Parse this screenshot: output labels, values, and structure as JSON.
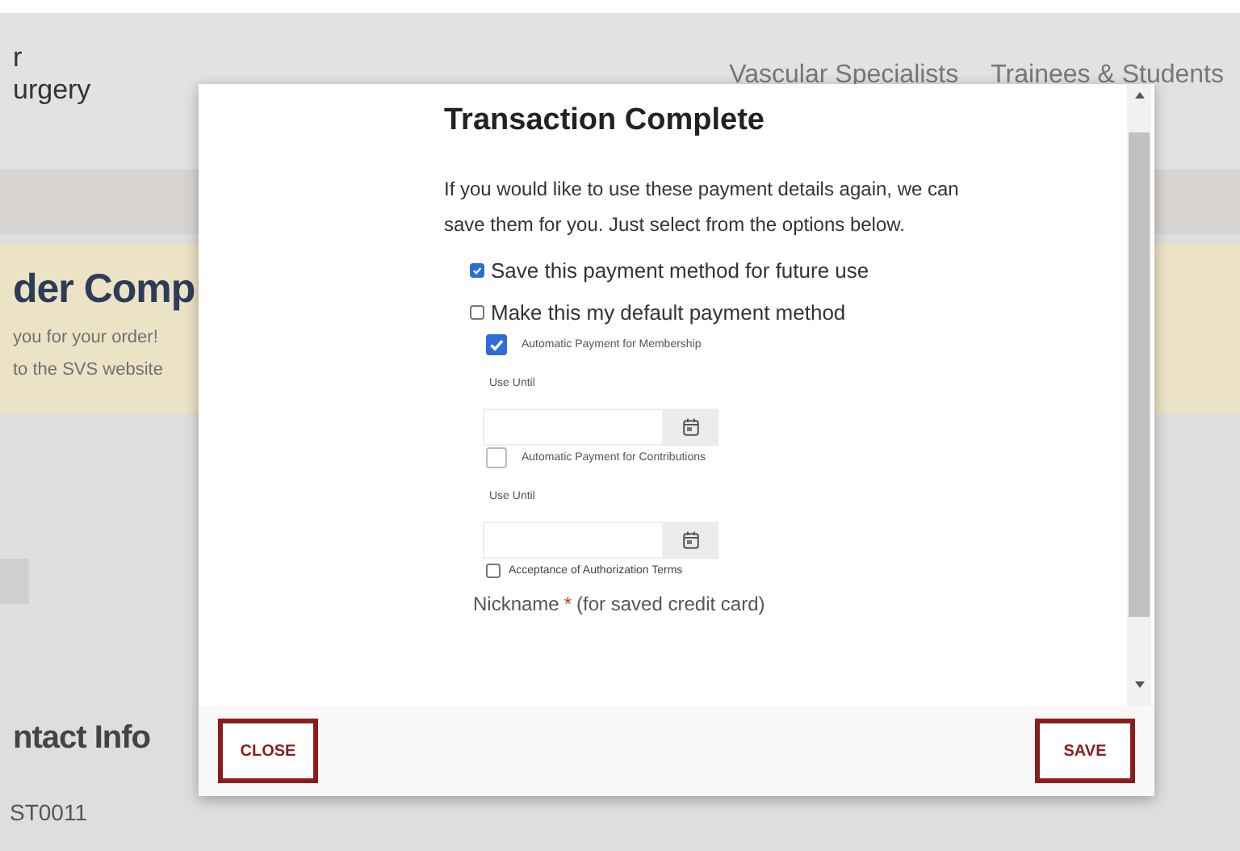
{
  "site": {
    "logo_lines": [
      "r",
      "urgery"
    ],
    "nav": [
      {
        "label": "Vascular Specialists"
      },
      {
        "label": "Trainees & Students"
      }
    ],
    "banner": {
      "title": "der Comp",
      "lines": [
        "you for your order!",
        "to the SVS website"
      ]
    },
    "section_title": "ntact Info",
    "record_id": "ST0011"
  },
  "modal": {
    "title": "Transaction Complete",
    "message": "If you would like to use these payment details again, we can save them for you. Just select from the options below.",
    "options": [
      {
        "kind": "main",
        "label": "Save this payment method for future use",
        "checked": true
      },
      {
        "kind": "main",
        "label": "Make this my default payment method",
        "checked": false
      },
      {
        "kind": "sub",
        "label": "Automatic Payment for Membership",
        "checked": true
      },
      {
        "kind": "date",
        "label": "Use Until"
      },
      {
        "kind": "sub",
        "label": "Automatic Payment for Contributions",
        "checked": false
      },
      {
        "kind": "date",
        "label": "Use Until"
      },
      {
        "kind": "terms",
        "label": "Acceptance of Authorization Terms",
        "checked": false
      }
    ],
    "nickname": {
      "label": "Nickname",
      "required_mark": "*",
      "hint": "(for saved credit card)"
    },
    "buttons": [
      {
        "label": "CLOSE"
      },
      {
        "label": "SAVE"
      }
    ]
  }
}
